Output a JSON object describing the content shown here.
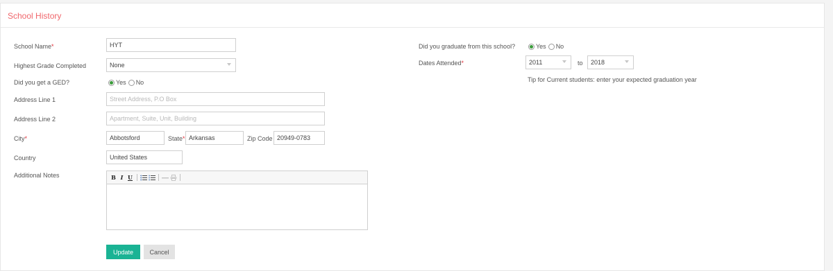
{
  "section": {
    "title": "School History"
  },
  "left": {
    "school_name": {
      "label": "School Name",
      "value": "HYT"
    },
    "grade": {
      "label": "Highest Grade Completed",
      "value": "None"
    },
    "ged": {
      "label": "Did you get a GED?",
      "yes": "Yes",
      "no": "No",
      "selected": "Yes"
    },
    "address1": {
      "label": "Address Line 1",
      "placeholder": "Street Address, P.O Box"
    },
    "address2": {
      "label": "Address Line 2",
      "placeholder": "Apartment, Suite, Unit, Building"
    },
    "city": {
      "label": "City",
      "value": "Abbotsford"
    },
    "state": {
      "label": "State",
      "value": "Arkansas"
    },
    "zip": {
      "label": "Zip Code",
      "value": "20949-0783"
    },
    "country": {
      "label": "Country",
      "value": "United States"
    },
    "notes": {
      "label": "Additional Notes",
      "toolbar": [
        "bold-icon",
        "italic-icon",
        "underline-icon",
        "bullet-list-icon",
        "numbered-list-icon",
        "horizontal-rule-icon",
        "print-icon"
      ]
    }
  },
  "right": {
    "graduate": {
      "label": "Did you graduate from this school?",
      "yes": "Yes",
      "no": "No",
      "selected": "Yes"
    },
    "dates": {
      "label": "Dates Attended",
      "from": "2011",
      "to_label": "to",
      "to": "2018"
    },
    "tip": "Tip for Current students: enter your expected graduation year"
  },
  "buttons": {
    "update": "Update",
    "cancel": "Cancel"
  },
  "colors": {
    "title": "#f0666b",
    "primary": "#1ab394",
    "required": "#e0313a",
    "radio_on": "#3a9b3a"
  }
}
